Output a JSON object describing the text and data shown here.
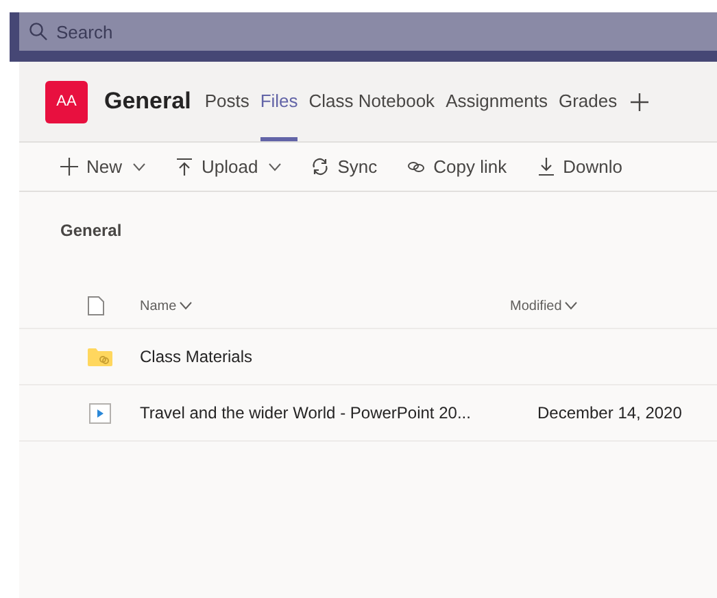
{
  "search": {
    "placeholder": "Search"
  },
  "team": {
    "initials": "AA",
    "color": "#e8103f",
    "channel": "General"
  },
  "tabs": [
    {
      "label": "Posts",
      "selected": false
    },
    {
      "label": "Files",
      "selected": true
    },
    {
      "label": "Class Notebook",
      "selected": false
    },
    {
      "label": "Assignments",
      "selected": false
    },
    {
      "label": "Grades",
      "selected": false
    }
  ],
  "toolbar": [
    {
      "kind": "new",
      "label": "New",
      "dropdown": true
    },
    {
      "kind": "upload",
      "label": "Upload",
      "dropdown": true
    },
    {
      "kind": "sync",
      "label": "Sync",
      "dropdown": false
    },
    {
      "kind": "link",
      "label": "Copy link",
      "dropdown": false
    },
    {
      "kind": "download",
      "label": "Downlo",
      "dropdown": false
    }
  ],
  "breadcrumb": "General",
  "table": {
    "columns": [
      "Name",
      "Modified"
    ],
    "rows": [
      {
        "kind": "folder",
        "name": "Class Materials",
        "modified": ""
      },
      {
        "kind": "pptx",
        "name": "Travel and the wider World - PowerPoint 20...",
        "modified": "December 14, 2020"
      }
    ]
  }
}
